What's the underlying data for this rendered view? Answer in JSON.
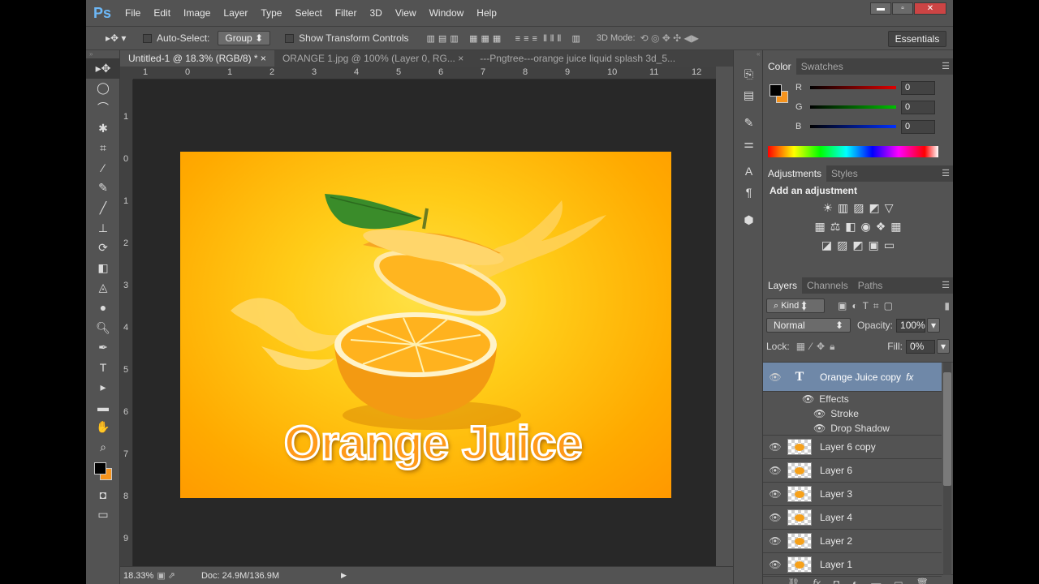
{
  "app": {
    "logo": "Ps"
  },
  "menu": [
    "File",
    "Edit",
    "Image",
    "Layer",
    "Type",
    "Select",
    "Filter",
    "3D",
    "View",
    "Window",
    "Help"
  ],
  "window_controls": {
    "minimize": "▬",
    "restore": "▫",
    "close": "✕"
  },
  "options": {
    "auto_select_label": "Auto-Select:",
    "auto_select_value": "Group",
    "show_transform_label": "Show Transform Controls",
    "mode_3d_label": "3D Mode:",
    "workspace": "Essentials"
  },
  "tabs": [
    {
      "label": "Untitled-1 @ 18.3% (RGB/8) *",
      "close": "×"
    },
    {
      "label": "ORANGE 1.jpg @ 100% (Layer 0, RG...",
      "close": "×"
    },
    {
      "label": "---Pngtree---orange juice liquid splash 3d_5..."
    }
  ],
  "ruler_top": [
    "1",
    "0",
    "1",
    "2",
    "3",
    "4",
    "5",
    "6",
    "7",
    "8",
    "9",
    "10",
    "11",
    "12"
  ],
  "ruler_left": [
    "1",
    "0",
    "1",
    "2",
    "3",
    "4",
    "5",
    "6",
    "7",
    "8",
    "9"
  ],
  "canvas": {
    "title": "Orange Juice"
  },
  "status": {
    "zoom": "18.33%",
    "doc": "Doc: 24.9M/136.9M"
  },
  "color_panel": {
    "tabs": [
      "Color",
      "Swatches"
    ],
    "channels": [
      {
        "label": "R",
        "value": "0",
        "color": "#e00000"
      },
      {
        "label": "G",
        "value": "0",
        "color": "#00c000"
      },
      {
        "label": "B",
        "value": "0",
        "color": "#0030ff"
      }
    ]
  },
  "adjust_panel": {
    "tabs": [
      "Adjustments",
      "Styles"
    ],
    "heading": "Add an adjustment"
  },
  "layers_panel": {
    "tabs": [
      "Layers",
      "Channels",
      "Paths"
    ],
    "filter_kind": "Kind",
    "blend_mode": "Normal",
    "opacity_label": "Opacity:",
    "opacity_value": "100%",
    "lock_label": "Lock:",
    "fill_label": "Fill:",
    "fill_value": "0%",
    "text_layer": {
      "name": "Orange Juice copy",
      "fx": "fx",
      "effects_label": "Effects",
      "effects": [
        "Stroke",
        "Drop Shadow"
      ]
    },
    "layers": [
      "Layer 6 copy",
      "Layer 6",
      "Layer 3",
      "Layer 4",
      "Layer 2",
      "Layer 1"
    ]
  }
}
